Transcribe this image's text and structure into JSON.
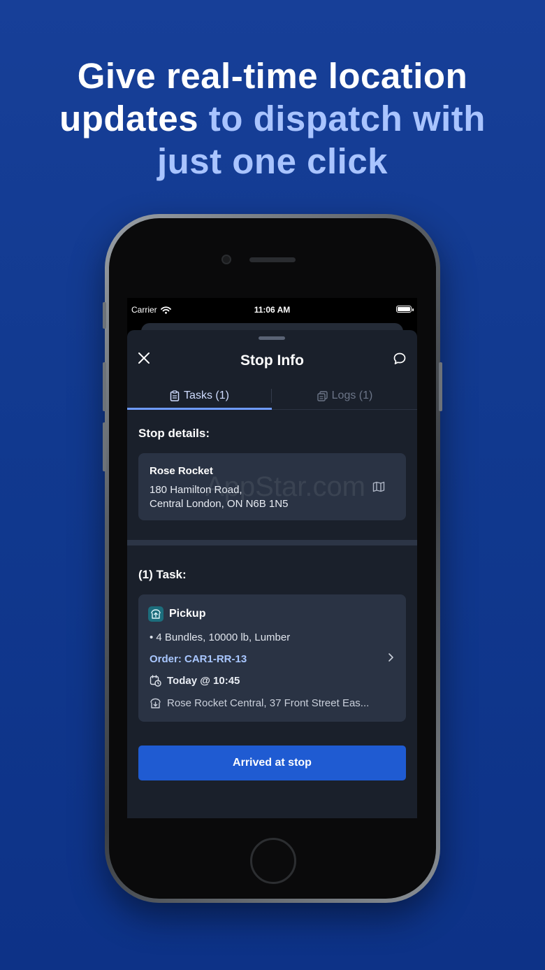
{
  "headline": {
    "part1": "Give real-time location updates ",
    "part2": "to dispatch with just one click"
  },
  "status_bar": {
    "carrier": "Carrier",
    "time": "11:06 AM"
  },
  "sheet": {
    "title": "Stop Info",
    "tabs": [
      {
        "label": "Tasks (1)",
        "active": true
      },
      {
        "label": "Logs (1)",
        "active": false
      }
    ]
  },
  "stop_details": {
    "heading": "Stop details:",
    "name": "Rose Rocket",
    "address_line1": "180 Hamilton Road,",
    "address_line2": "Central London, ON N6B 1N5"
  },
  "watermark": "AppStar.com",
  "task_section": {
    "heading": "(1) Task:",
    "task": {
      "type": "Pickup",
      "details": "• 4 Bundles, 10000 lb, Lumber",
      "order": "Order: CAR1-RR-13",
      "when": "Today @ 10:45",
      "where": "Rose Rocket Central, 37 Front Street Eas..."
    }
  },
  "primary_action": "Arrived at stop",
  "colors": {
    "background": "#11398f",
    "accent": "#1f5bd2",
    "headline_highlight": "#a9c4ff",
    "card": "#2a3344"
  }
}
